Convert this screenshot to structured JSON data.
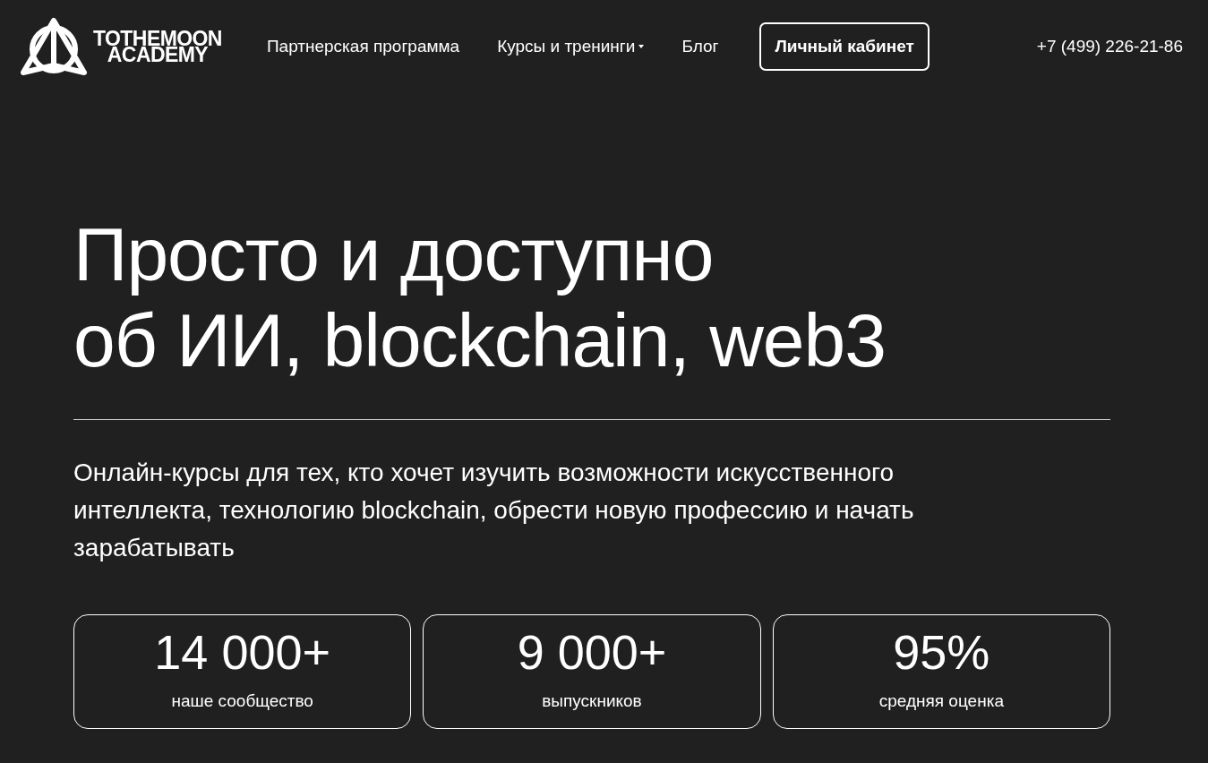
{
  "logo": {
    "line1": "TOTHEMOON",
    "line2": "ACADEMY"
  },
  "nav": [
    {
      "label": "Партнерская программа",
      "dropdown": false
    },
    {
      "label": "Курсы и тренинги",
      "dropdown": true
    },
    {
      "label": "Блог",
      "dropdown": false
    }
  ],
  "account_button": "Личный кабинет",
  "phone": "+7 (499) 226-21-86",
  "headline": [
    "Просто и доступно",
    "об ИИ, blockchain, web3"
  ],
  "subtitle": "Онлайн-курсы для тех, кто хочет изучить возможности искусственного интеллекта, технологию blockchain, обрести новую профессию и начать зарабатывать",
  "stats": [
    {
      "value": "14 000+",
      "label": "наше сообщество"
    },
    {
      "value": "9 000+",
      "label": "выпускников"
    },
    {
      "value": "95%",
      "label": "средняя оценка"
    }
  ]
}
